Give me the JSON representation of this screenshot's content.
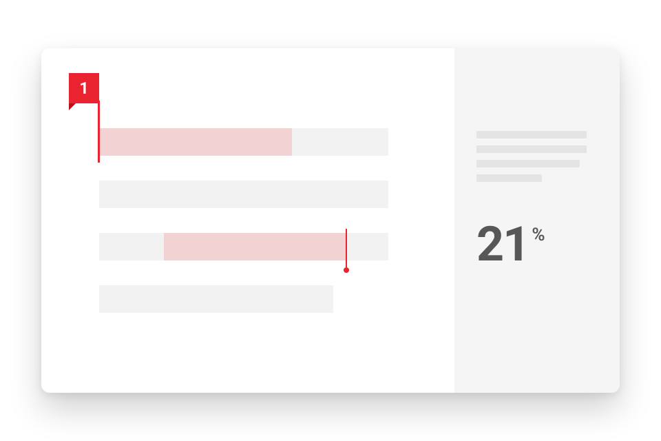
{
  "badge": {
    "label": "1"
  },
  "sidebar": {
    "percent_value": "21",
    "percent_symbol": "%"
  }
}
